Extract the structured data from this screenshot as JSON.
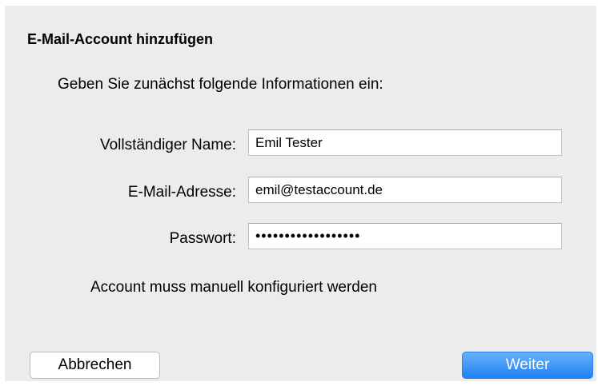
{
  "dialog": {
    "title": "E-Mail-Account hinzufügen",
    "intro": "Geben Sie zunächst folgende Informationen ein:",
    "fields": {
      "name": {
        "label": "Vollständiger Name:",
        "value": "Emil Tester"
      },
      "email": {
        "label": "E-Mail-Adresse:",
        "value": "emil@testaccount.de"
      },
      "password": {
        "label": "Passwort:",
        "value": "••••••••••••••••••"
      }
    },
    "status": "Account muss manuell konfiguriert werden",
    "buttons": {
      "cancel": "Abbrechen",
      "next": "Weiter"
    },
    "colors": {
      "background": "#ececec",
      "primary_button": "#1d80f6"
    }
  }
}
